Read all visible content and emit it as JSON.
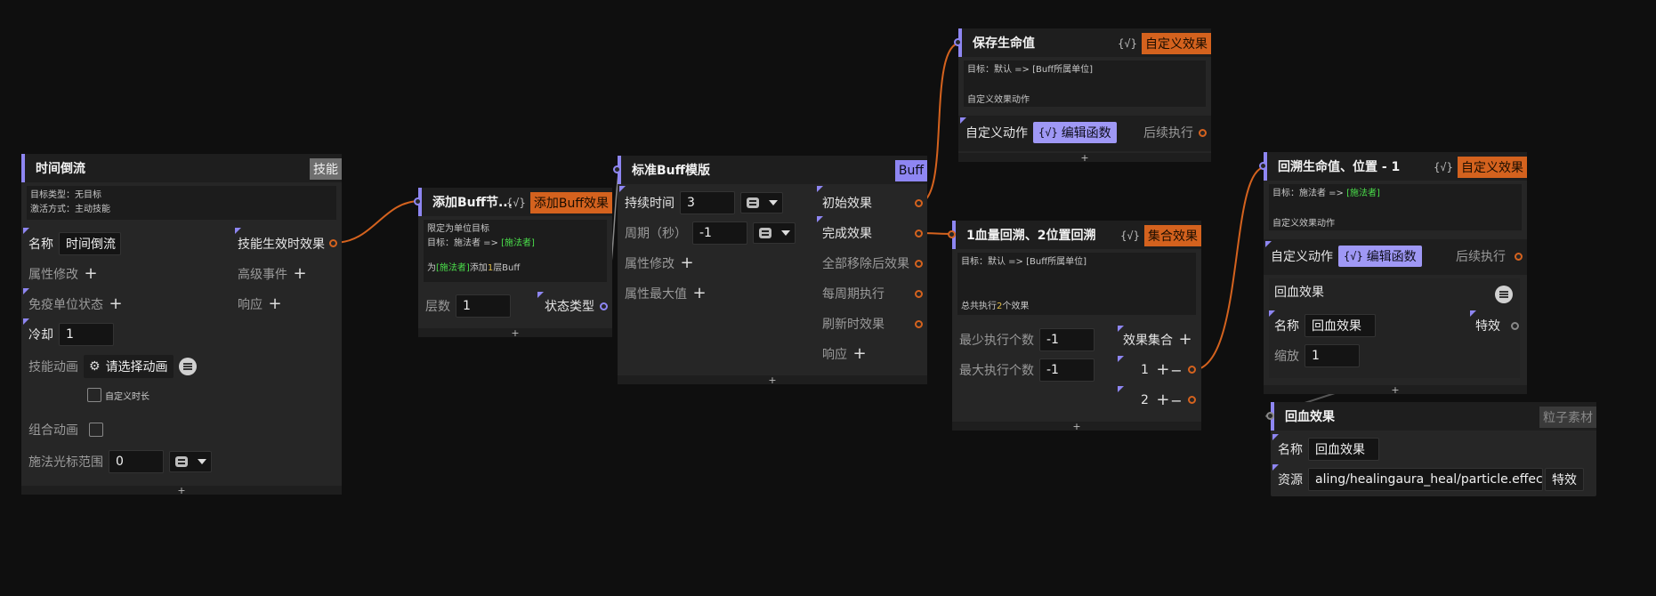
{
  "nodes": {
    "skill": {
      "title": "时间倒流",
      "badge": "技能",
      "desc": [
        "目标类型：无目标",
        "激活方式：主动技能"
      ],
      "name_label": "名称",
      "name_value": "时间倒流",
      "attr_mod": "属性修改",
      "immune": "免疫单位状态",
      "cooldown_label": "冷却",
      "cooldown_value": "1",
      "anim_label": "技能动画",
      "anim_value": "请选择动画",
      "custom_duration": "自定义时长",
      "combo_anim": "组合动画",
      "cursor_range_label": "施法光标范围",
      "cursor_range_value": "0",
      "out_effect": "技能生效时效果",
      "adv_event": "高级事件",
      "response": "响应",
      "footer": "+"
    },
    "add_buff": {
      "title": "添加Buff节...",
      "fx": "{√}",
      "badge": "添加Buff效果",
      "desc1": "限定为单位目标",
      "desc2_prefix": "目标：施法者 => ",
      "desc2_hl": "[施法者]",
      "desc3_a": "为",
      "desc3_hl": "[施法者]",
      "desc3_b": "添加",
      "desc3_num": "1",
      "desc3_c": "层Buff",
      "layers_label": "层数",
      "layers_value": "1",
      "state_type": "状态类型",
      "footer": "+"
    },
    "buff": {
      "title": "标准Buff模版",
      "badge": "Buff",
      "duration_label": "持续时间",
      "duration_value": "3",
      "period_label": "周期（秒）",
      "period_value": "-1",
      "attr_mod": "属性修改",
      "attr_max": "属性最大值",
      "out_initial": "初始效果",
      "out_complete": "完成效果",
      "out_remove_all": "全部移除后效果",
      "out_periodic": "每周期执行",
      "out_refresh": "刷新时效果",
      "response": "响应",
      "footer": "+"
    },
    "save_hp": {
      "title": "保存生命值",
      "fx": "{√}",
      "badge": "自定义效果",
      "desc1": "目标：默认 => [Buff所属单位]",
      "desc2": "自定义效果动作",
      "action_label": "自定义动作",
      "edit_fn": "编辑函数",
      "after": "后续执行",
      "footer": "+"
    },
    "set_effect": {
      "title": "1血量回溯、2位置回溯",
      "fx": "{√}",
      "badge": "集合效果",
      "desc1": "目标：默认 => [Buff所属单位]",
      "desc2_a": "总共执行",
      "desc2_num": "2",
      "desc2_b": "个效果",
      "min_label": "最少执行个数",
      "min_value": "-1",
      "max_label": "最大执行个数",
      "max_value": "-1",
      "set_label": "效果集合",
      "item1": "1",
      "item2": "2",
      "footer": "+"
    },
    "rewind": {
      "title": "回溯生命值、位置 - 1",
      "fx": "{√}",
      "badge": "自定义效果",
      "desc1_prefix": "目标：施法者 => ",
      "desc1_hl": "[施法者]",
      "desc2": "自定义效果动作",
      "action_label": "自定义动作",
      "edit_fn": "编辑函数",
      "after": "后续执行",
      "sub_title": "回血效果",
      "sub_name_label": "名称",
      "sub_name_value": "回血效果",
      "sub_fx_label": "特效",
      "sub_scale_label": "缩放",
      "sub_scale_value": "1",
      "footer": "+"
    },
    "particle": {
      "title": "回血效果",
      "badge": "粒子素材",
      "name_label": "名称",
      "name_value": "回血效果",
      "res_label": "资源",
      "res_value": "aling/healingaura_heal/particle.effect",
      "fx_label": "特效"
    }
  },
  "colors": {
    "accent": "#8e86f2",
    "wire": "#d4621e",
    "orange": "#d4621e"
  }
}
